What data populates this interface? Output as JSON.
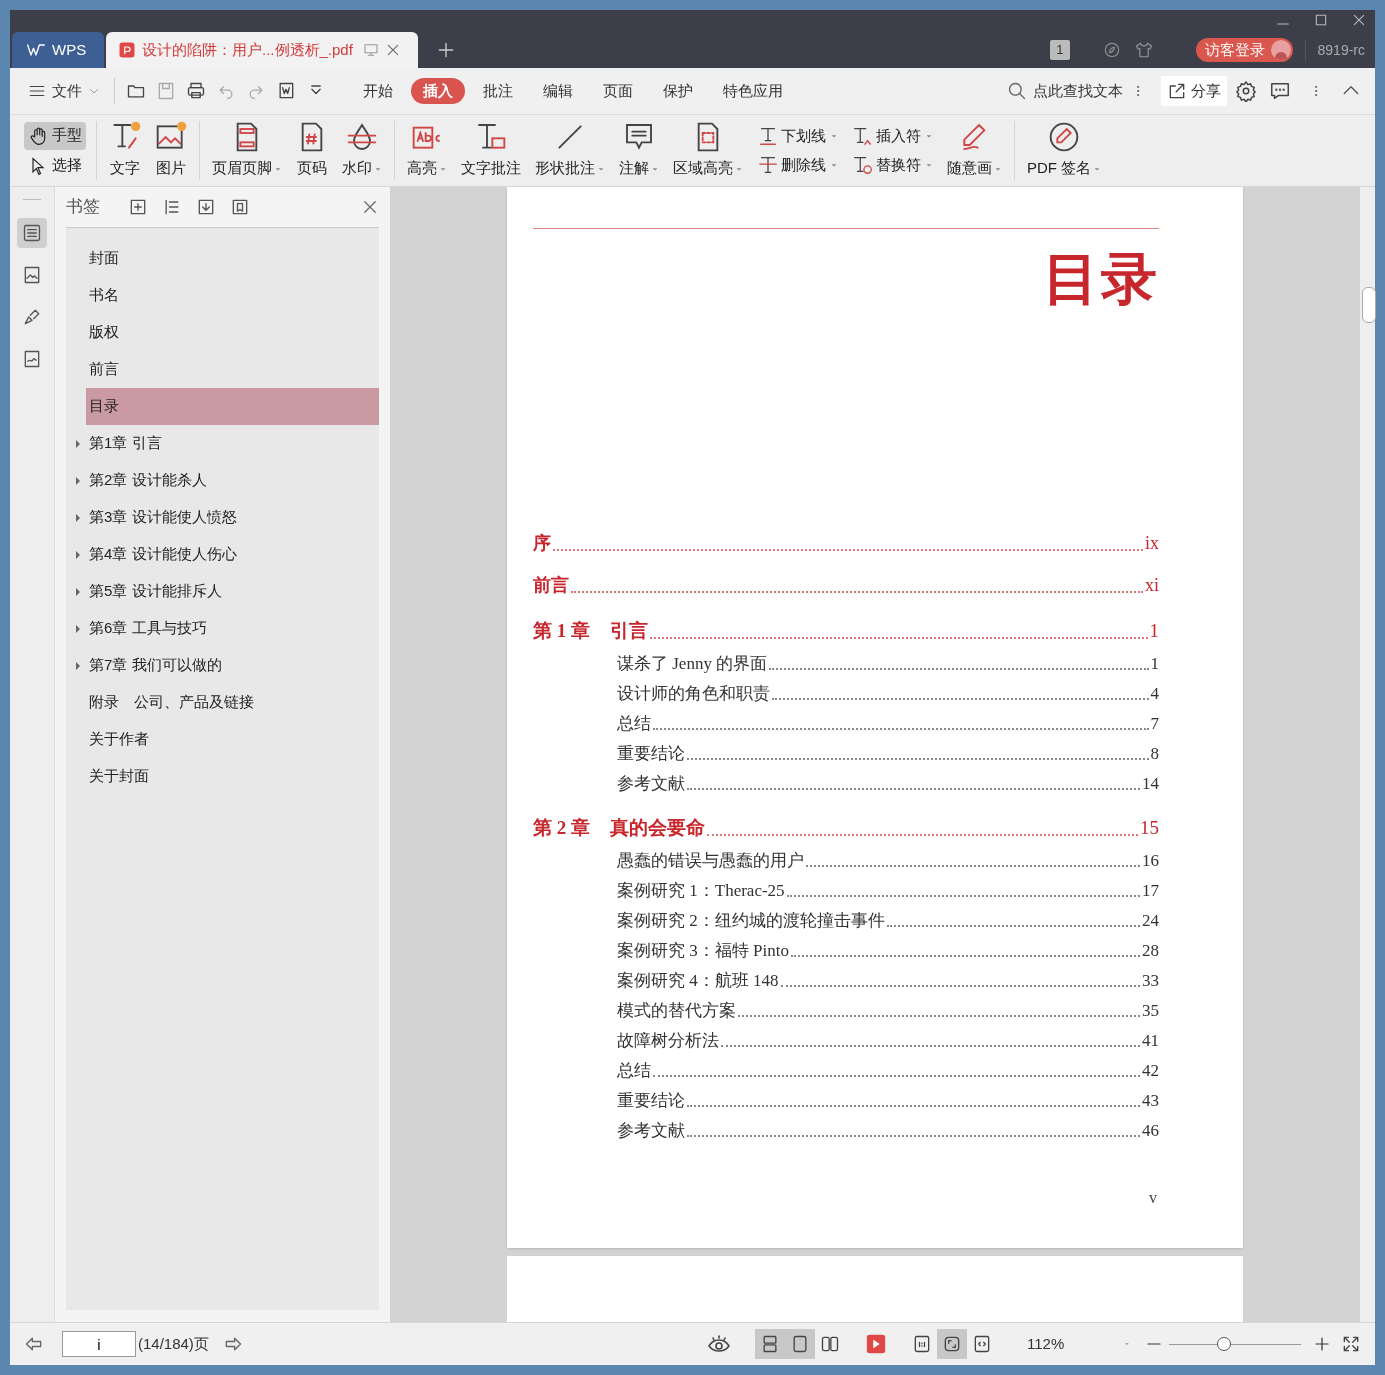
{
  "title_bar": {
    "app_tab": "WPS",
    "doc_tab": "设计的陷阱：用户...例透析_.pdf",
    "counter": "1",
    "login": "访客登录",
    "user": "8919-rc"
  },
  "menu": {
    "file": "文件",
    "tabs": [
      {
        "label": "开始",
        "selected": false
      },
      {
        "label": "插入",
        "selected": true
      },
      {
        "label": "批注",
        "selected": false
      },
      {
        "label": "编辑",
        "selected": false
      },
      {
        "label": "页面",
        "selected": false
      },
      {
        "label": "保护",
        "selected": false
      },
      {
        "label": "特色应用",
        "selected": false
      }
    ],
    "search": "点此查找文本",
    "share": "分享"
  },
  "ribbon": {
    "groups": [
      [
        {
          "kind": "modes",
          "items": [
            {
              "label": "手型",
              "selected": true
            },
            {
              "label": "选择",
              "selected": false
            }
          ]
        }
      ],
      [
        {
          "kind": "large",
          "label": "文字",
          "dropdown": false
        },
        {
          "kind": "large",
          "label": "图片",
          "dropdown": false
        }
      ],
      [
        {
          "kind": "large",
          "label": "页眉页脚",
          "dropdown": true
        },
        {
          "kind": "large",
          "label": "页码",
          "dropdown": false
        },
        {
          "kind": "large",
          "label": "水印",
          "dropdown": true
        }
      ],
      [
        {
          "kind": "large",
          "label": "高亮",
          "dropdown": true
        },
        {
          "kind": "large",
          "label": "文字批注",
          "dropdown": false
        },
        {
          "kind": "large",
          "label": "形状批注",
          "dropdown": true
        },
        {
          "kind": "large",
          "label": "注解",
          "dropdown": true
        },
        {
          "kind": "large",
          "label": "区域高亮",
          "dropdown": true
        },
        {
          "kind": "stack",
          "items": [
            {
              "label": "下划线",
              "dropdown": true
            },
            {
              "label": "删除线",
              "dropdown": true
            }
          ]
        },
        {
          "kind": "stack",
          "items": [
            {
              "label": "插入符",
              "dropdown": true
            },
            {
              "label": "替换符",
              "dropdown": true
            }
          ]
        },
        {
          "kind": "large",
          "label": "随意画",
          "dropdown": true
        }
      ],
      [
        {
          "kind": "large",
          "label": "PDF 签名",
          "dropdown": true
        }
      ]
    ]
  },
  "side_rail": [
    {
      "selected": true
    },
    {
      "selected": false
    },
    {
      "selected": false
    },
    {
      "selected": false
    }
  ],
  "bookmarks": {
    "title": "书签",
    "items": [
      {
        "label": "封面",
        "kind": "leaf",
        "selected": false
      },
      {
        "label": "书名",
        "kind": "leaf",
        "selected": false
      },
      {
        "label": "版权",
        "kind": "leaf",
        "selected": false
      },
      {
        "label": "前言",
        "kind": "leaf",
        "selected": false
      },
      {
        "label": "目录",
        "kind": "leaf",
        "selected": true
      },
      {
        "label": "第1章 引言",
        "kind": "collapsed",
        "selected": false
      },
      {
        "label": "第2章 设计能杀人",
        "kind": "collapsed",
        "selected": false
      },
      {
        "label": "第3章 设计能使人愤怒",
        "kind": "collapsed",
        "selected": false
      },
      {
        "label": "第4章 设计能使人伤心",
        "kind": "collapsed",
        "selected": false
      },
      {
        "label": "第5章 设计能排斥人",
        "kind": "collapsed",
        "selected": false
      },
      {
        "label": "第6章 工具与技巧",
        "kind": "collapsed",
        "selected": false
      },
      {
        "label": "第7章 我们可以做的",
        "kind": "collapsed",
        "selected": false
      },
      {
        "label": "附录　公司、产品及链接",
        "kind": "leaf",
        "selected": false
      },
      {
        "label": "关于作者",
        "kind": "leaf",
        "selected": false
      },
      {
        "label": "关于封面",
        "kind": "leaf",
        "selected": false
      }
    ]
  },
  "page": {
    "heading": "目录",
    "entries": [
      {
        "kind": "part",
        "title": "序",
        "page": "ix"
      },
      {
        "kind": "part",
        "title": "前言",
        "page": "xi"
      },
      {
        "kind": "chapter",
        "number": "第 1 章",
        "title": "引言",
        "page": "1"
      },
      {
        "kind": "section",
        "title": "谋杀了 Jenny 的界面",
        "page": "1"
      },
      {
        "kind": "section",
        "title": "设计师的角色和职责",
        "page": "4"
      },
      {
        "kind": "section",
        "title": "总结",
        "page": "7"
      },
      {
        "kind": "section",
        "title": "重要结论",
        "page": "8"
      },
      {
        "kind": "section",
        "title": "参考文献",
        "page": "14"
      },
      {
        "kind": "chapter",
        "number": "第 2 章",
        "title": "真的会要命",
        "page": "15"
      },
      {
        "kind": "section",
        "title": "愚蠢的错误与愚蠢的用户",
        "page": "16"
      },
      {
        "kind": "section",
        "title": "案例研究 1：Therac-25",
        "page": "17"
      },
      {
        "kind": "section",
        "title": "案例研究 2：纽约城的渡轮撞击事件",
        "page": "24"
      },
      {
        "kind": "section",
        "title": "案例研究 3：福特 Pinto",
        "page": "28"
      },
      {
        "kind": "section",
        "title": "案例研究 4：航班 148",
        "page": "33"
      },
      {
        "kind": "section",
        "title": "模式的替代方案",
        "page": "35"
      },
      {
        "kind": "section",
        "title": "故障树分析法",
        "page": "41"
      },
      {
        "kind": "section",
        "title": "总结",
        "page": "42"
      },
      {
        "kind": "section",
        "title": "重要结论",
        "page": "43"
      },
      {
        "kind": "section",
        "title": "参考文献",
        "page": "46"
      }
    ],
    "folio": "v"
  },
  "status_bar": {
    "page_input": "i",
    "page_count": "(14/184)页",
    "view_modes": [
      {
        "selected": true
      },
      {
        "selected": true
      },
      {
        "selected": false
      }
    ],
    "fit_modes": [
      {
        "selected": false
      },
      {
        "selected": true
      },
      {
        "selected": false
      }
    ],
    "zoom": "112%",
    "zoom_slider": {
      "level": 0.42
    }
  }
}
